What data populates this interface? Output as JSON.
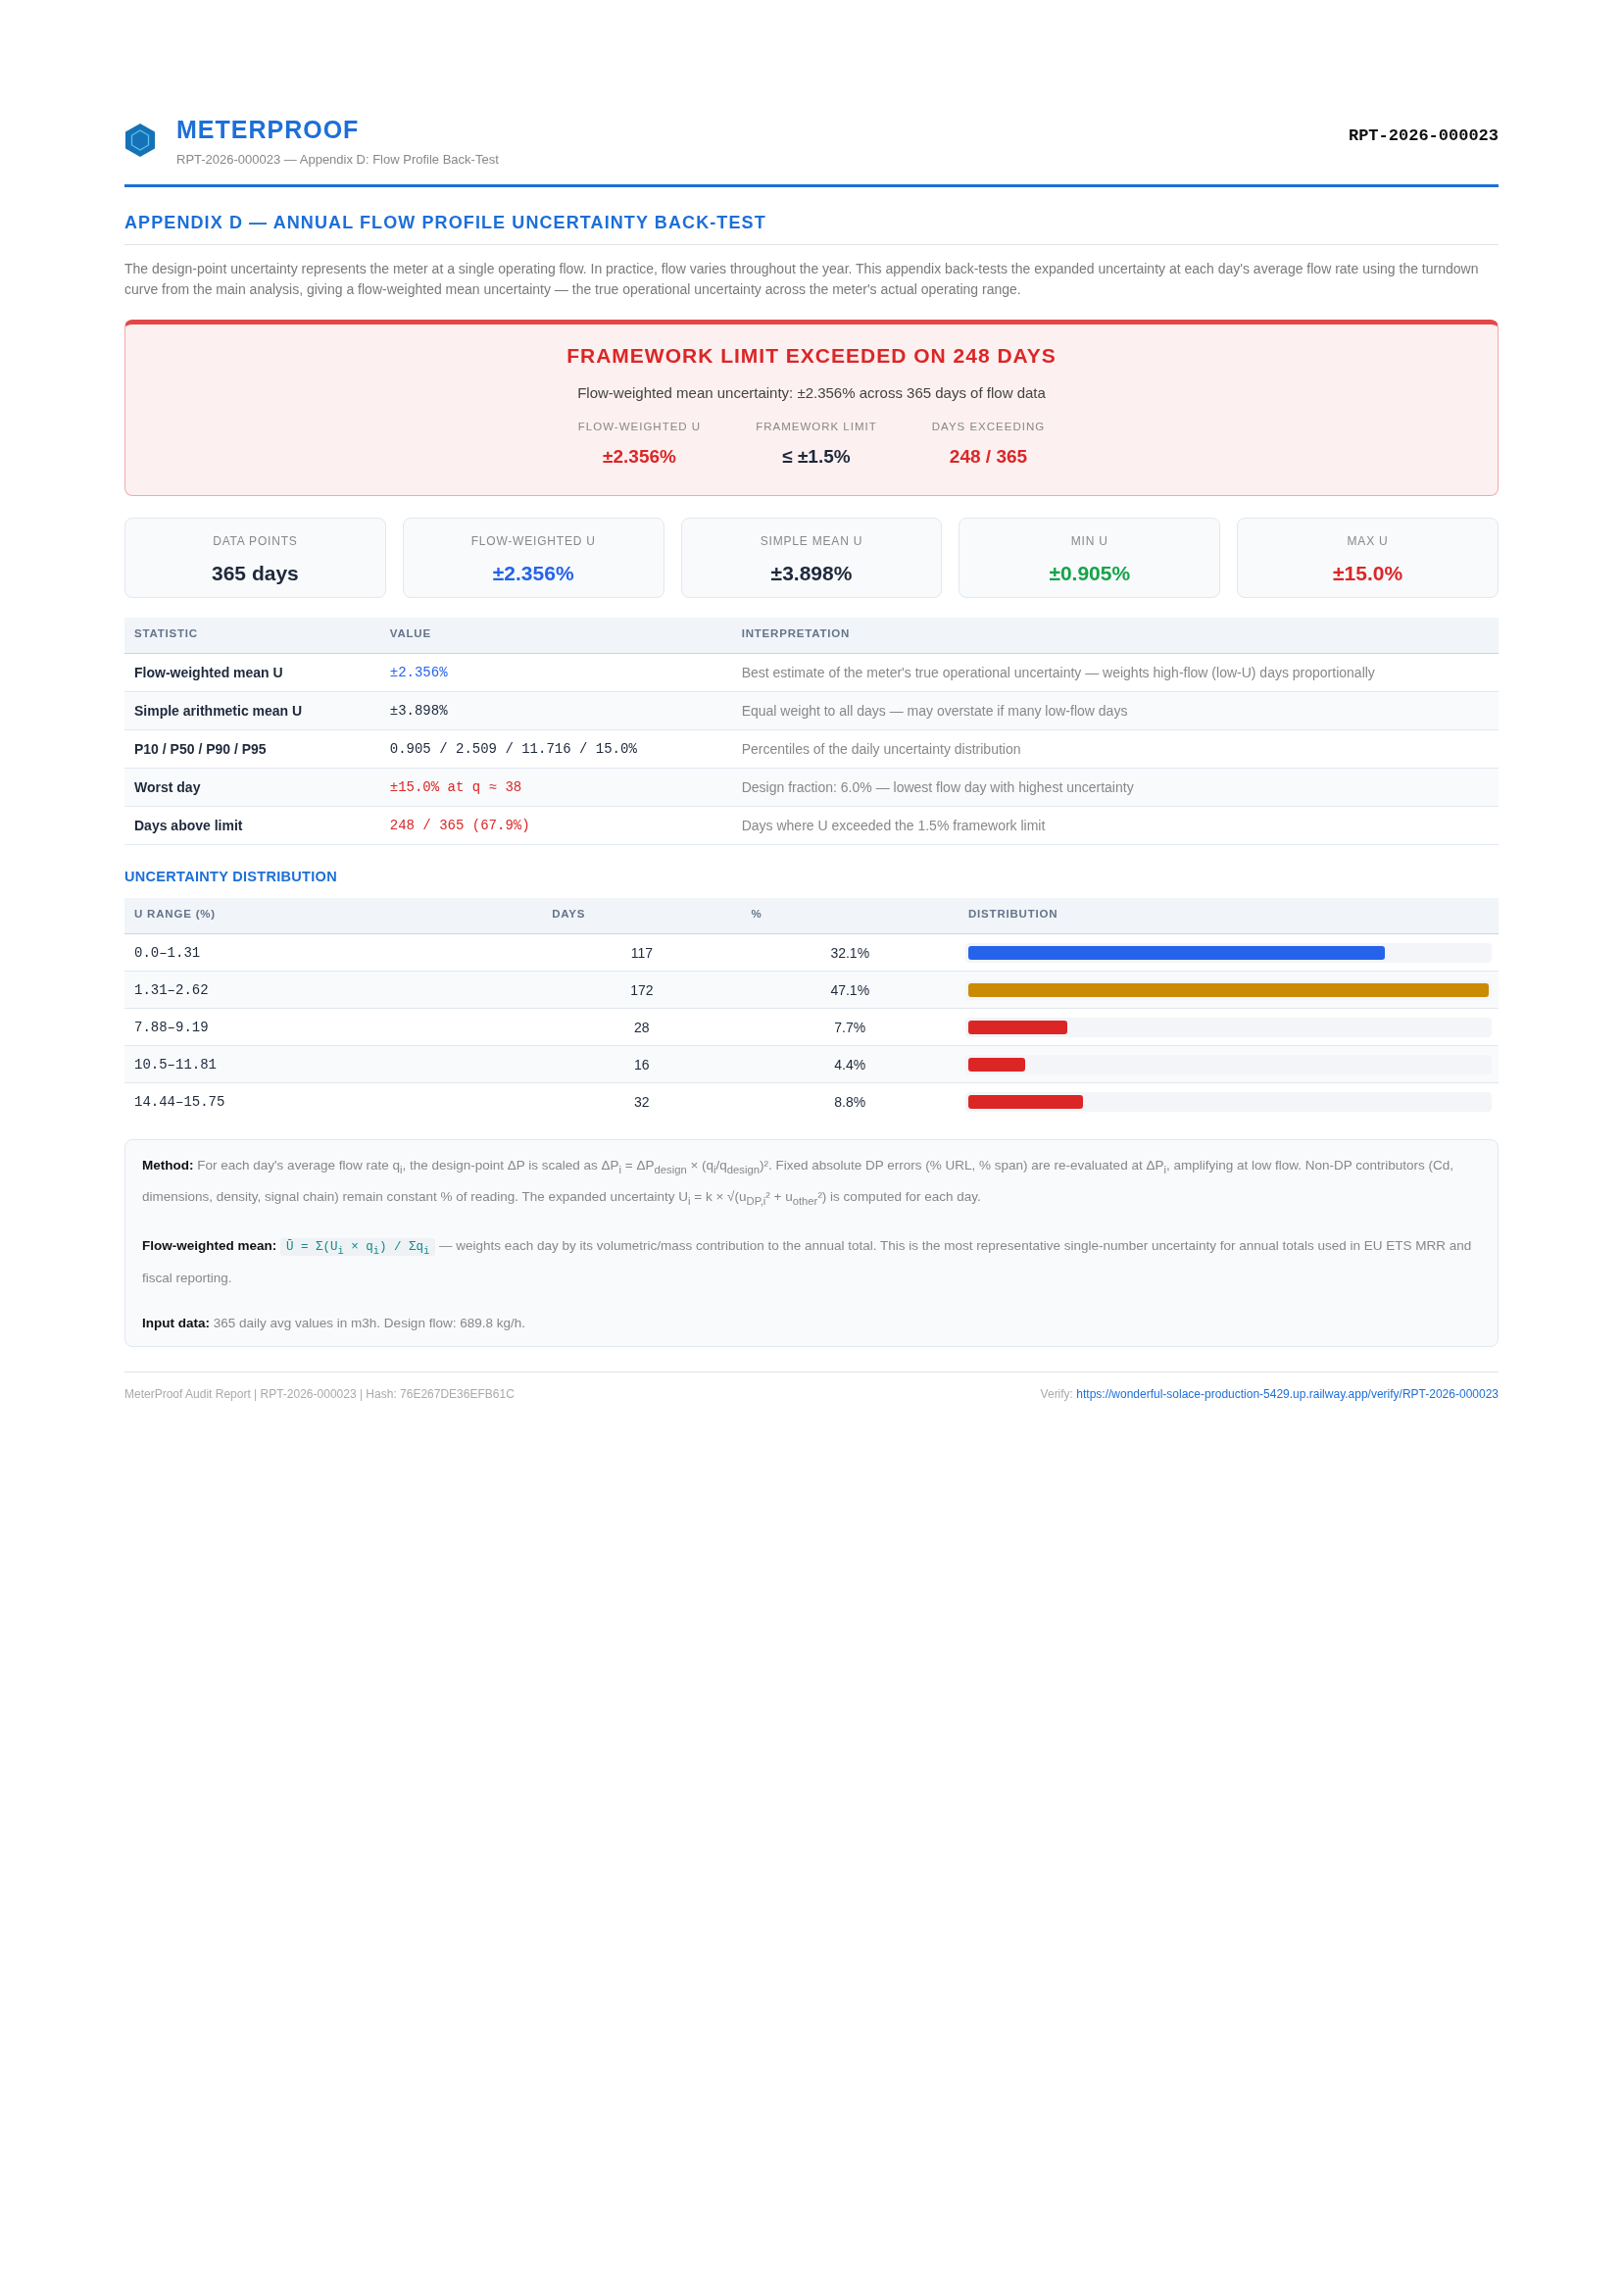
{
  "header": {
    "brand": "METERPROOF",
    "subtitle": "RPT-2026-000023 — Appendix D: Flow Profile Back-Test",
    "report_id": "RPT-2026-000023"
  },
  "section_title": "APPENDIX D — ANNUAL FLOW PROFILE UNCERTAINTY BACK-TEST",
  "intro": "The design-point uncertainty represents the meter at a single operating flow. In practice, flow varies throughout the year. This appendix back-tests the expanded uncertainty at each day's average flow rate using the turndown curve from the main analysis, giving a flow-weighted mean uncertainty — the true operational uncertainty across the meter's actual operating range.",
  "alert": {
    "title": "FRAMEWORK LIMIT EXCEEDED ON 248 DAYS",
    "summary": "Flow-weighted mean uncertainty: ±2.356% across 365 days of flow data",
    "metrics": [
      {
        "label": "FLOW-WEIGHTED U",
        "value": "±2.356%",
        "color": "#dc2626"
      },
      {
        "label": "FRAMEWORK LIMIT",
        "value": "≤ ±1.5%",
        "color": "#1e293b"
      },
      {
        "label": "DAYS EXCEEDING",
        "value": "248 / 365",
        "color": "#dc2626"
      }
    ]
  },
  "cards": [
    {
      "label": "DATA POINTS",
      "value": "365 days",
      "color": "#1e293b"
    },
    {
      "label": "FLOW-WEIGHTED U",
      "value": "±2.356%",
      "color": "#2563eb"
    },
    {
      "label": "SIMPLE MEAN U",
      "value": "±3.898%",
      "color": "#1e293b"
    },
    {
      "label": "MIN U",
      "value": "±0.905%",
      "color": "#16a34a"
    },
    {
      "label": "MAX U",
      "value": "±15.0%",
      "color": "#dc2626"
    }
  ],
  "stats_table": {
    "columns": [
      "STATISTIC",
      "VALUE",
      "INTERPRETATION"
    ],
    "rows": [
      {
        "statistic": "Flow-weighted mean U",
        "value": "±2.356%",
        "color": "#2563eb",
        "interpretation": "Best estimate of the meter's true operational uncertainty — weights high-flow (low-U) days proportionally"
      },
      {
        "statistic": "Simple arithmetic mean U",
        "value": "±3.898%",
        "color": "#1e293b",
        "interpretation": "Equal weight to all days — may overstate if many low-flow days"
      },
      {
        "statistic": "P10 / P50 / P90 / P95",
        "value": "0.905 / 2.509 / 11.716 / 15.0%",
        "color": "#1e293b",
        "interpretation": "Percentiles of the daily uncertainty distribution"
      },
      {
        "statistic": "Worst day",
        "value": "±15.0% at q ≈ 38",
        "color": "#dc2626",
        "interpretation": "Design fraction: 6.0% — lowest flow day with highest uncertainty"
      },
      {
        "statistic": "Days above limit",
        "value": "248 / 365 (67.9%)",
        "color": "#dc2626",
        "interpretation": "Days where U exceeded the 1.5% framework limit"
      }
    ]
  },
  "distribution_title": "UNCERTAINTY DISTRIBUTION",
  "distribution_table": {
    "columns": [
      "U RANGE (%)",
      "DAYS",
      "%",
      "DISTRIBUTION"
    ],
    "rows": [
      {
        "range": "0.0–1.31",
        "days": "117",
        "percent": "32.1%",
        "level": 0.8,
        "color": "#2563eb"
      },
      {
        "range": "1.31–2.62",
        "days": "172",
        "percent": "47.1%",
        "level": 1,
        "color": "#ca8a04"
      },
      {
        "range": "7.88–9.19",
        "days": "28",
        "percent": "7.7%",
        "level": 0.19,
        "color": "#dc2626"
      },
      {
        "range": "10.5–11.81",
        "days": "16",
        "percent": "4.4%",
        "level": 0.11,
        "color": "#dc2626"
      },
      {
        "range": "14.44–15.75",
        "days": "32",
        "percent": "8.8%",
        "level": 0.22,
        "color": "#dc2626"
      }
    ]
  },
  "notes": [
    {
      "label": "Method:",
      "text": "For each day's average flow rate q$_{i}$, the design-point ΔP is scaled as ΔP$_{i}$ = ΔP$_{design}$ × (q$_{i}$/q$_{design}$)². Fixed absolute DP errors (% URL, % span) are re-evaluated at ΔP$_{i}$, amplifying at low flow. Non-DP contributors (Cd, dimensions, density, signal chain) remain constant % of reading. The expanded uncertainty U$_{i}$ = k × √(u$_{DP,i}$² + u$_{other}$²) is computed for each day."
    },
    {
      "label": "Flow-weighted mean:",
      "formula": "Ū = Σ(U$_{i}$ × q$_{i}$) / Σq$_{i}$",
      "text": "— weights each day by its volumetric/mass contribution to the annual total. This is the most representative single-number uncertainty for annual totals used in EU ETS MRR and fiscal reporting."
    },
    {
      "label": "Input data:",
      "text": "365 daily avg values in m3h. Design flow: 689.8 kg/h."
    }
  ],
  "footer": {
    "left": "MeterProof Audit Report | RPT-2026-000023 | Hash: 76E267DE36EFB61C",
    "verify_label": "Verify:",
    "verify_link": "https://wonderful-solace-production-5429.up.railway.app/verify/RPT-2026-000023"
  }
}
